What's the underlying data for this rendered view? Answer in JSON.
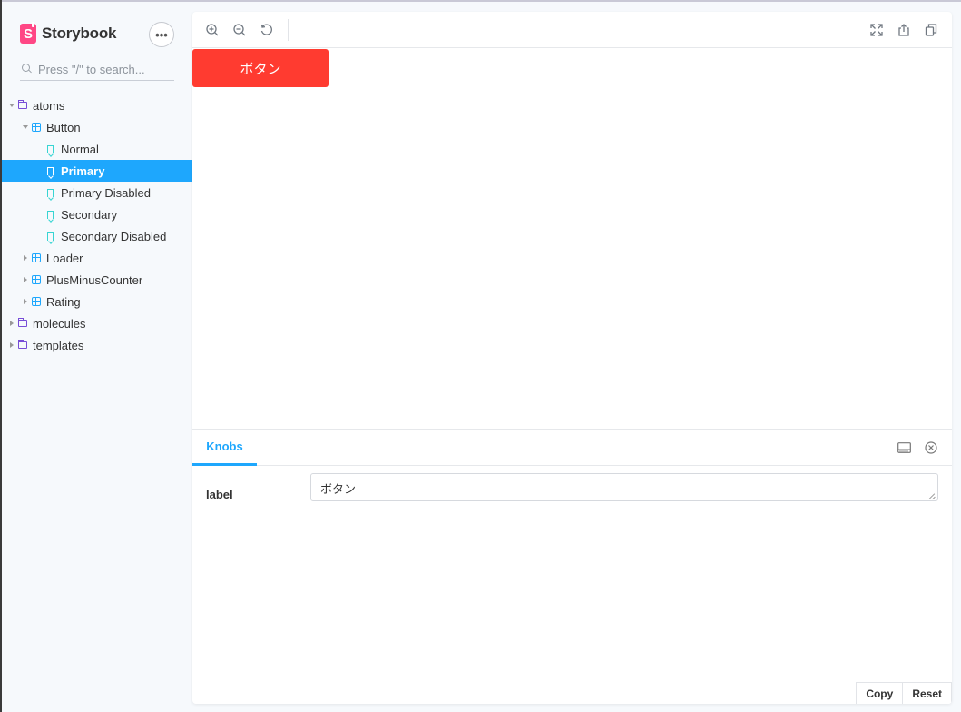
{
  "sidebar": {
    "brand": {
      "logo_letter": "S",
      "name": "Storybook"
    },
    "menu_label": "•••",
    "search": {
      "placeholder": "Press \"/\" to search..."
    },
    "tree": [
      {
        "label": "atoms",
        "type": "folder",
        "depth": 0,
        "expanded": true
      },
      {
        "label": "Button",
        "type": "component",
        "depth": 1,
        "expanded": true
      },
      {
        "label": "Normal",
        "type": "story",
        "depth": 2
      },
      {
        "label": "Primary",
        "type": "story",
        "depth": 2,
        "selected": true
      },
      {
        "label": "Primary Disabled",
        "type": "story",
        "depth": 2
      },
      {
        "label": "Secondary",
        "type": "story",
        "depth": 2
      },
      {
        "label": "Secondary Disabled",
        "type": "story",
        "depth": 2
      },
      {
        "label": "Loader",
        "type": "component",
        "depth": 1,
        "expanded": false
      },
      {
        "label": "PlusMinusCounter",
        "type": "component",
        "depth": 1,
        "expanded": false
      },
      {
        "label": "Rating",
        "type": "component",
        "depth": 1,
        "expanded": false
      },
      {
        "label": "molecules",
        "type": "folder",
        "depth": 0,
        "expanded": false
      },
      {
        "label": "templates",
        "type": "folder",
        "depth": 0,
        "expanded": false
      }
    ]
  },
  "toolbar": {
    "left_icons": [
      "zoom-in-icon",
      "zoom-out-icon",
      "zoom-reset-icon"
    ],
    "right_icons": [
      "fullscreen-icon",
      "share-icon",
      "copy-link-icon"
    ]
  },
  "preview": {
    "button_label": "ボタン",
    "button_color": "#ff3b30"
  },
  "addons": {
    "active_tab": "Knobs",
    "panel_icons": [
      "panel-position-icon",
      "close-panel-icon"
    ],
    "knobs": [
      {
        "label": "label",
        "value": "ボタン"
      }
    ],
    "actions": {
      "copy": "Copy",
      "reset": "Reset"
    }
  },
  "colors": {
    "accent": "#1ea7fd",
    "brand": "#ff4785",
    "folder": "#774dd7",
    "story": "#37d5d3"
  }
}
